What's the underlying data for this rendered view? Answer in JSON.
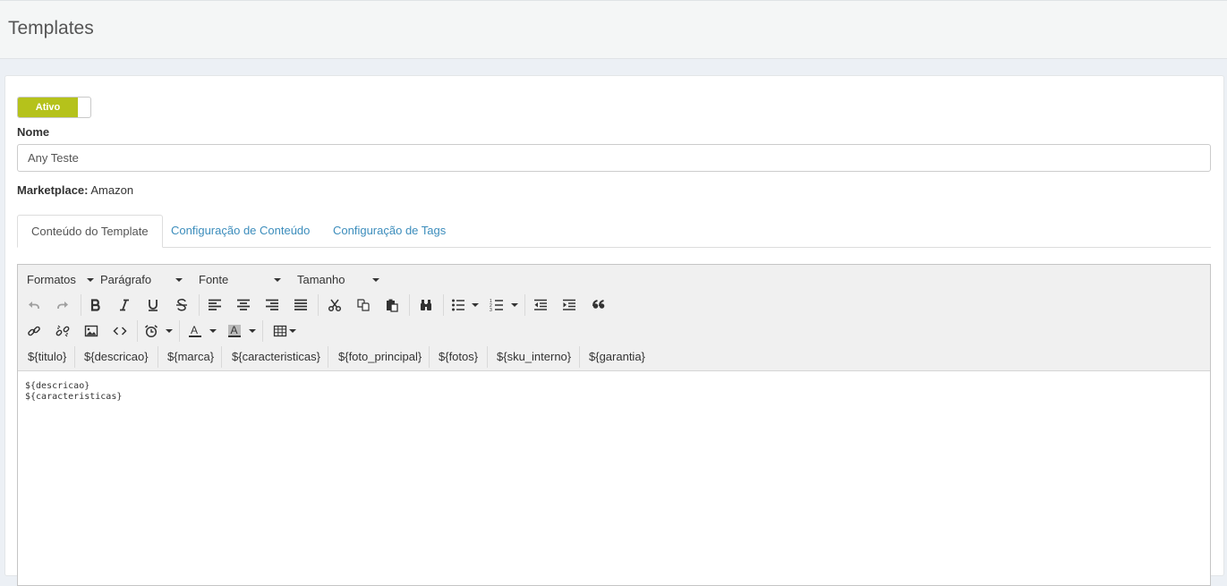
{
  "header": {
    "title": "Templates"
  },
  "form": {
    "toggle_label": "Ativo",
    "toggle_on": true,
    "name_label": "Nome",
    "name_value": "Any Teste",
    "marketplace_label": "Marketplace:",
    "marketplace_value": "Amazon"
  },
  "tabs": [
    {
      "label": "Conteúdo do Template",
      "active": true
    },
    {
      "label": "Configuração de Conteúdo",
      "active": false
    },
    {
      "label": "Configuração de Tags",
      "active": false
    }
  ],
  "editor": {
    "menus": {
      "formats": "Formatos",
      "block": "Parágrafo",
      "font": "Fonte",
      "size": "Tamanho"
    },
    "tags": [
      "${titulo}",
      "${descricao}",
      "${marca}",
      "${caracteristicas}",
      "${foto_principal}",
      "${fotos}",
      "${sku_interno}",
      "${garantia}"
    ],
    "content_lines": [
      "${descricao}",
      "${caracteristicas}"
    ]
  },
  "colors": {
    "toggle_active": "#b5c21b",
    "link": "#3c8dbc"
  }
}
